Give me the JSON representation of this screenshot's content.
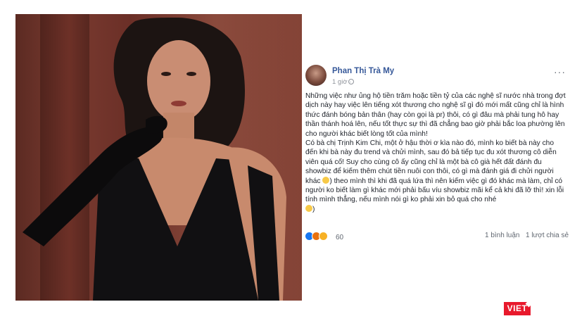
{
  "post": {
    "author": "Phan Thị Trà My",
    "time": "1 giờ ·",
    "more_label": "···",
    "paragraphs": [
      "Những việc như ủng hộ tiền trăm hoặc tiền tỷ của các nghệ sĩ nước nhà trong đợt dịch này hay việc lên tiếng xót thương cho nghệ sĩ gì đó mới mất cũng chỉ là hình thức đánh bóng bản thân (hay còn gọi là pr) thôi, có gì đâu mà phải tung hô hay thần thánh hoá lên, nếu tốt thực sự thì đã chẳng bao giờ phải bắc loa phường lên cho người khác biết lòng tốt của mình!",
      "Có bà chị Trịnh Kim Chi, một ở hậu thời ơ kìa nào đó, mình ko biết bà này cho đến khi bà này đu trend và chửi mình, sau đó bả tiếp tục đu xót thương cô diễn viên quá cố! Suy cho cùng cô ấy cũng chỉ là một bà cô già hết đất đánh đu showbiz để kiếm thêm chút tiền nuôi con thôi, có gì mà đánh giá đi chửi người khác",
      ") theo mình thì khi đã quá lứa thì nên kiếm việc gì đó khác mà làm, chỉ có người ko biết làm gì khác mới phải bấu víu showbiz mãi kể cả khi đã lỡ thì! xin lỗi tính mình thẳng, nếu mình nói gì ko phải xin bỏ quá cho nhé",
      ")"
    ],
    "reaction_count": "60",
    "comments": "1 bình luận",
    "shares": "1 lượt chia sẻ"
  },
  "logo_text": "VIET",
  "colors": {
    "link": "#365899",
    "meta": "#90949c",
    "text": "#1d2129",
    "logo": "#e8192c"
  }
}
